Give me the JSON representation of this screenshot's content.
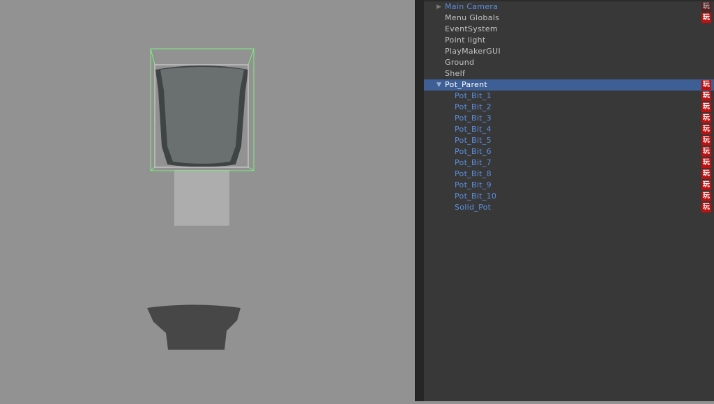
{
  "hierarchy": {
    "items": [
      {
        "label": "Main Camera",
        "indent": 0,
        "arrow": "right",
        "blue": true,
        "icon": "playmaker-icon-partial"
      },
      {
        "label": "Menu Globals",
        "indent": 0,
        "blue": false,
        "icon": "playmaker-icon"
      },
      {
        "label": "EventSystem",
        "indent": 0,
        "blue": false
      },
      {
        "label": "Point light",
        "indent": 0,
        "blue": false
      },
      {
        "label": "PlayMakerGUI",
        "indent": 0,
        "blue": false
      },
      {
        "label": "Ground",
        "indent": 0,
        "blue": false
      },
      {
        "label": "Shelf",
        "indent": 0,
        "blue": false
      },
      {
        "label": "Pot_Parent",
        "indent": 0,
        "arrow": "down",
        "blue": true,
        "selected": true,
        "icon": "playmaker-icon"
      },
      {
        "label": "Pot_Bit_1",
        "indent": 1,
        "blue": true,
        "icon": "playmaker-icon"
      },
      {
        "label": "Pot_Bit_2",
        "indent": 1,
        "blue": true,
        "icon": "playmaker-icon"
      },
      {
        "label": "Pot_Bit_3",
        "indent": 1,
        "blue": true,
        "icon": "playmaker-icon"
      },
      {
        "label": "Pot_Bit_4",
        "indent": 1,
        "blue": true,
        "icon": "playmaker-icon"
      },
      {
        "label": "Pot_Bit_5",
        "indent": 1,
        "blue": true,
        "icon": "playmaker-icon"
      },
      {
        "label": "Pot_Bit_6",
        "indent": 1,
        "blue": true,
        "icon": "playmaker-icon"
      },
      {
        "label": "Pot_Bit_7",
        "indent": 1,
        "blue": true,
        "icon": "playmaker-icon"
      },
      {
        "label": "Pot_Bit_8",
        "indent": 1,
        "blue": true,
        "icon": "playmaker-icon"
      },
      {
        "label": "Pot_Bit_9",
        "indent": 1,
        "blue": true,
        "icon": "playmaker-icon"
      },
      {
        "label": "Pot_Bit_10",
        "indent": 1,
        "blue": true,
        "icon": "playmaker-icon"
      },
      {
        "label": "Solid_Pot",
        "indent": 1,
        "blue": true,
        "icon": "playmaker-icon"
      }
    ],
    "icon_glyph": "玩"
  },
  "colors": {
    "selection": "#3e5f96",
    "prefab_text": "#5b8fe0",
    "viewport": "#929292",
    "panel": "#383838"
  }
}
